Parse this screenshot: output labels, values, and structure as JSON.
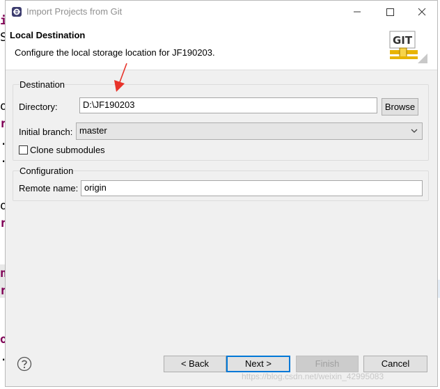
{
  "background": {
    "editor_glyphs": [
      "i",
      "S",
      "o",
      "r",
      ".",
      ".",
      "o",
      "r",
      "n",
      "r",
      "o",
      "."
    ]
  },
  "window": {
    "title": "Import Projects from Git",
    "app_icon": "eclipse-icon",
    "controls": [
      "minimize-icon",
      "maximize-icon",
      "close-icon"
    ]
  },
  "banner": {
    "title": "Local Destination",
    "description": "Configure the local storage location for JF190203.",
    "logo_text": "GIT"
  },
  "destination": {
    "group_title": "Destination",
    "directory_label": "Directory:",
    "directory_value": "D:\\JF190203",
    "browse_label": "Browse",
    "initial_branch_label": "Initial branch:",
    "initial_branch_value": "master",
    "clone_submodules_label": "Clone submodules",
    "clone_submodules_checked": false
  },
  "configuration": {
    "group_title": "Configuration",
    "remote_name_label": "Remote name:",
    "remote_name_value": "origin"
  },
  "footer": {
    "help_icon": "help-icon",
    "back_label": "< Back",
    "next_label": "Next >",
    "finish_label": "Finish",
    "cancel_label": "Cancel"
  },
  "watermark": "https://blog.csdn.net/weixin_42995083",
  "colors": {
    "dialog_bg": "#f0f0f0",
    "focus_blue": "#0078d7",
    "annotation_red": "#e8332a",
    "keyword_purple": "#7f0055"
  }
}
